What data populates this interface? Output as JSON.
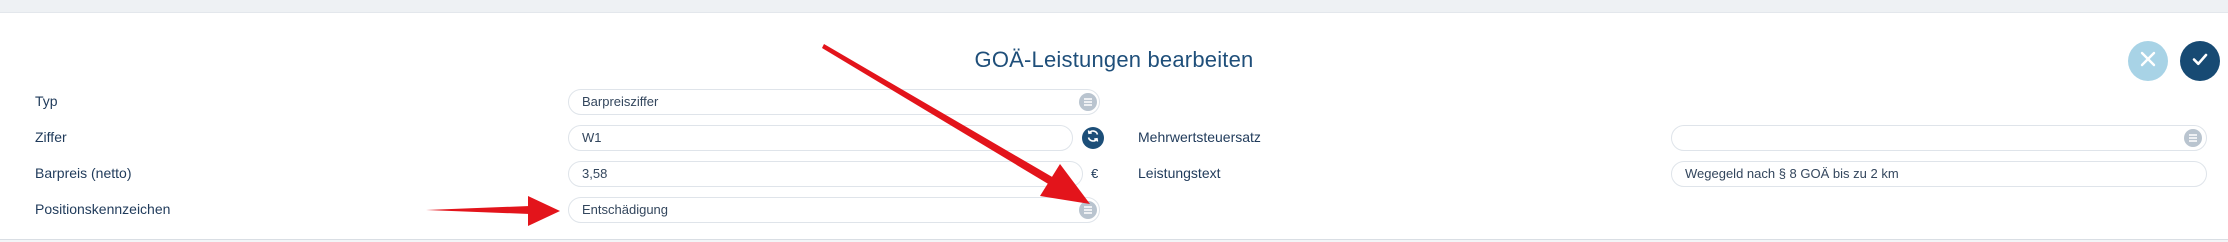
{
  "dialog": {
    "title": "GOÄ-Leistungen bearbeiten"
  },
  "fields": {
    "typ": {
      "label": "Typ",
      "value": "Barpreisziffer"
    },
    "ziffer": {
      "label": "Ziffer",
      "value": "W1"
    },
    "barpreis": {
      "label": "Barpreis (netto)",
      "value": "3,58",
      "unit": "€"
    },
    "positionskennzeichen": {
      "label": "Positionskennzeichen",
      "value": "Entschädigung"
    },
    "mehrwertsteuersatz": {
      "label": "Mehrwertsteuersatz",
      "value": ""
    },
    "leistungstext": {
      "label": "Leistungstext",
      "value": "Wegegeld nach § 8 GOÄ bis zu 2 km"
    }
  },
  "icons": {
    "close": "close-icon",
    "confirm": "check-icon",
    "menu": "list-icon",
    "refresh": "refresh-icon"
  },
  "colors": {
    "primary": "#174a73",
    "close_button": "#a8d3e6",
    "annotation_arrow": "#e3141b"
  }
}
